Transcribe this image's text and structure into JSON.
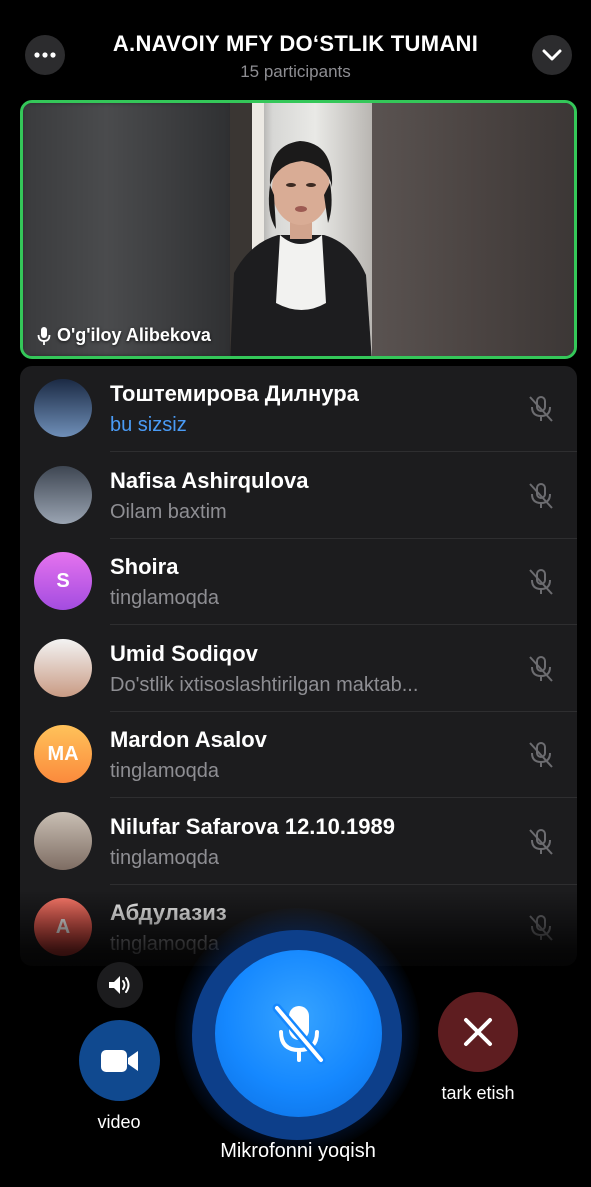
{
  "header": {
    "title": "A.NAVOIY MFY DO‘STLIK TUMANI",
    "participants": "15 participants",
    "more_icon": "more-horizontal-icon",
    "collapse_icon": "chevron-down-icon"
  },
  "video_tile": {
    "speaker_name": "O'g'iloy Alibekova",
    "border_color": "#34c759"
  },
  "participants": [
    {
      "name": "Тоштемирова Дилнура",
      "status": "bu sizsiz",
      "status_color": "#4a9bf5",
      "avatar_type": "photo",
      "avatar_colors": [
        "#1b2a44",
        "#6f8fb8"
      ]
    },
    {
      "name": "Nafisa Ashirqulova",
      "status": "Oilam baxtim",
      "avatar_type": "photo",
      "avatar_colors": [
        "#3e4652",
        "#9aa4b2"
      ]
    },
    {
      "name": "Shoira",
      "status": "tinglamoqda",
      "avatar_type": "initials",
      "initials": "S",
      "avatar_colors": [
        "#e573ee",
        "#a34ce0"
      ]
    },
    {
      "name": "Umid Sodiqov",
      "status": "Do'stlik ixtisoslashtirilgan maktab...",
      "avatar_type": "photo",
      "avatar_colors": [
        "#f3f3f3",
        "#c99b84"
      ]
    },
    {
      "name": "Mardon Asalov",
      "status": "tinglamoqda",
      "avatar_type": "initials",
      "initials": "MA",
      "avatar_colors": [
        "#ffc25a",
        "#fb8a3c"
      ]
    },
    {
      "name": "Nilufar Safarova 12.10.1989",
      "status": "tinglamoqda",
      "avatar_type": "photo",
      "avatar_colors": [
        "#c9bfb4",
        "#7e6d63"
      ]
    },
    {
      "name": "Абдулазиз",
      "status": "tinglamoqda",
      "avatar_type": "initials",
      "initials": "A",
      "avatar_colors": [
        "#ff7b6b",
        "#e0433c"
      ]
    }
  ],
  "controls": {
    "video_label": "video",
    "mic_label": "Mikrofonni yoqish",
    "leave_label": "tark etish",
    "speaker_icon": "speaker-volume-icon",
    "video_icon": "video-camera-icon",
    "mic_icon": "microphone-muted-icon",
    "leave_icon": "close-x-icon",
    "mic_color": "#1588ff",
    "leave_color": "#5e1d20"
  }
}
